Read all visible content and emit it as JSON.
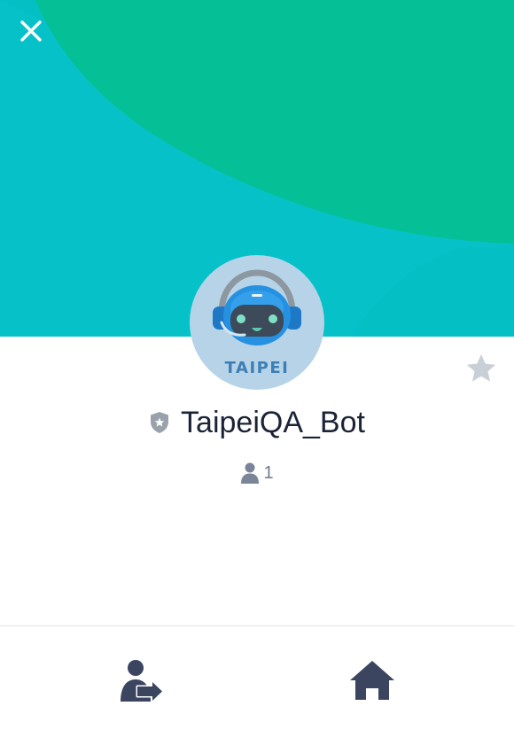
{
  "header": {
    "close_icon": "close-icon",
    "cover_colors": {
      "teal": "#06c1c8",
      "green": "#05c096"
    }
  },
  "profile": {
    "avatar_text": "TAIPEI",
    "name": "TaipeiQA_Bot",
    "badge_icon": "shield-star-icon",
    "favorite_icon": "star-icon",
    "member_icon": "person-icon",
    "member_count": "1"
  },
  "bottom_nav": {
    "items": [
      {
        "icon": "add-friend-icon"
      },
      {
        "icon": "home-icon"
      }
    ]
  }
}
